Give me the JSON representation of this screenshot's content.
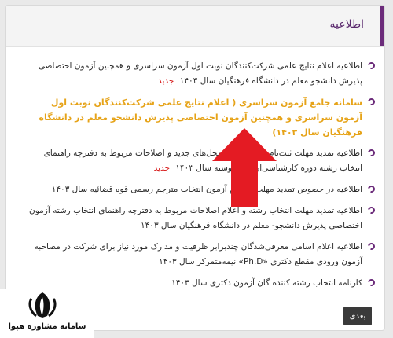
{
  "panel": {
    "title": "اطلاعیه"
  },
  "items": [
    {
      "text": "اطلاعیه اعلام نتایج علمی شرکت‌کنندگان نوبت اول آزمون سراسری و همچنین آزمون اختصاصی پذیرش دانشجو معلم در دانشگاه فرهنگیان سال ۱۴۰۳",
      "badge": "جدید"
    },
    {
      "text": "سامانه جامع آزمون سراسری ( اعلام نتایج علمی شرکت‌کنندگان نوبت اول آزمون سراسری و همچنین آزمون اختصاصی پذیرش دانشجو معلم در دانشگاه فرهنگیان سال ۱۴۰۳)"
    },
    {
      "text": "اطلاعیه تمدید مهلت ثبت‌نام و اعلام رشته‌محل‌های جدید و اصلاحات مربوط به دفترچه راهنمای انتخاب رشته دوره کارشناسی‌ارشد ناپیوسته سال ۱۴۰۳",
      "badge": "جدید"
    },
    {
      "text": "اطلاعیه در خصوص تمدید مهلت ثبت‌نام آزمون انتخاب مترجم رسمی قوه قضائیه سال ۱۴۰۳"
    },
    {
      "text": "اطلاعیه تمدید مهلت انتخاب رشته و اعلام اصلاحات مربوط به دفترچه راهنمای انتخاب رشته آزمون اختصاصی پذیرش دانشجو- معلم در دانشگاه فرهنگیان سال ۱۴۰۳"
    },
    {
      "text": "اطلاعیه اعلام اسامی معرفی‌شدگان چندبرابر ظرفیت و مدارک مورد نیاز برای شرکت در مصاحبه آزمون ورودی مقطع دکتری «Ph.D» نیمه‌متمرکز سال ۱۴۰۳"
    },
    {
      "text": "کارنامه انتخاب رشته کننده گان آزمون دکتری سال ۱۴۰۳"
    }
  ],
  "pagination": {
    "next_label": "بعدی"
  },
  "logo": {
    "text": "سامانه مشاوره هپوا"
  },
  "colors": {
    "accent": "#6b2b7a",
    "highlight": "#e6a318",
    "badge": "#d82020",
    "arrow": "#e41b23"
  }
}
